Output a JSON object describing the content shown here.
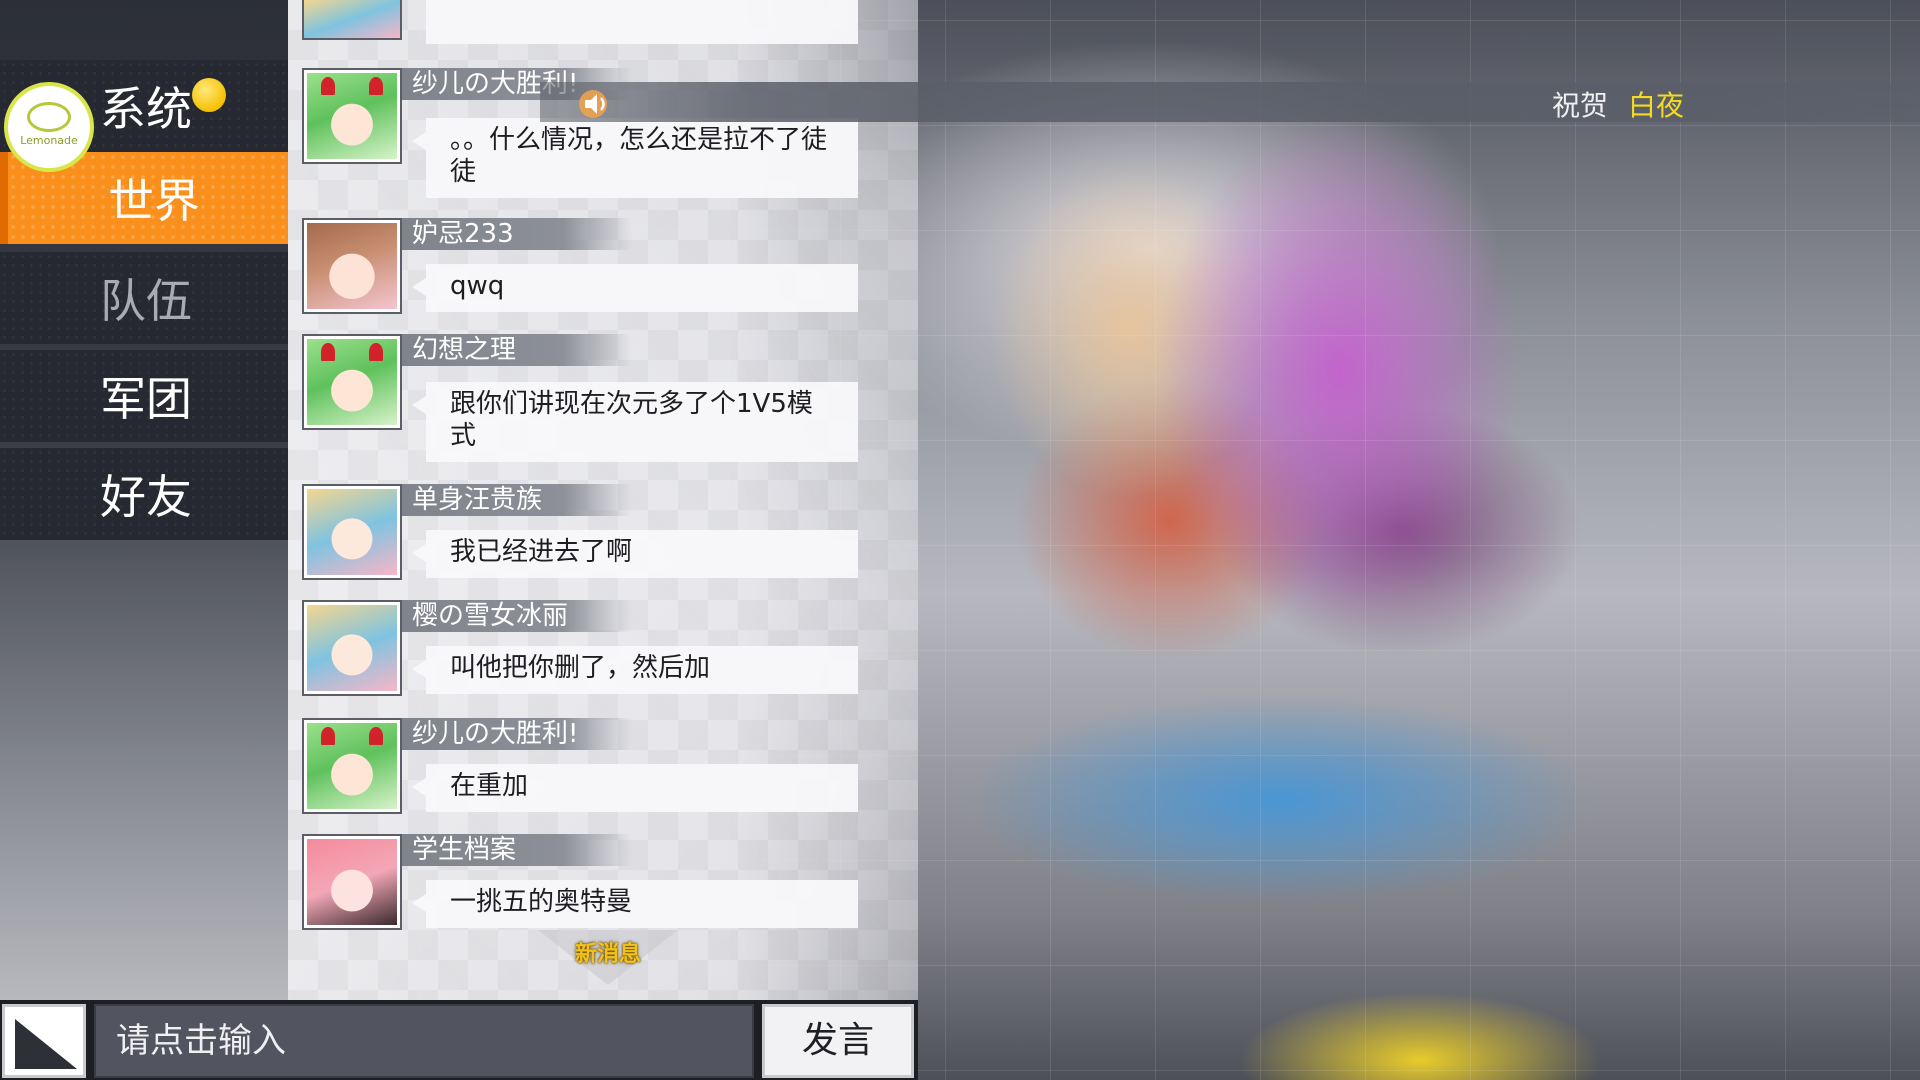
{
  "sidebar": {
    "items": [
      {
        "label": "系统"
      },
      {
        "label": "世界"
      },
      {
        "label": "队伍"
      },
      {
        "label": "军团"
      },
      {
        "label": "好友"
      }
    ],
    "active_index": 1,
    "logo_text": "Lemonade"
  },
  "banner": {
    "congrats": "祝贺",
    "name": "白夜"
  },
  "messages": [
    {
      "name": "纱儿の大胜利!",
      "text": "。。什么情况，怎么还是拉不了徒徒",
      "avatar": "green-hair-horns"
    },
    {
      "name": "妒忌233",
      "text": "qwq",
      "avatar": "brown-hair"
    },
    {
      "name": "幻想之理",
      "text": "跟你们讲现在次元多了个1V5模式",
      "avatar": "green-hair-horns"
    },
    {
      "name": "单身汪贵族",
      "text": "我已经进去了啊",
      "avatar": "blonde-hair"
    },
    {
      "name": "樱の雪女冰丽",
      "text": "叫他把你删了，然后加",
      "avatar": "blonde-hair"
    },
    {
      "name": "纱儿の大胜利!",
      "text": "在重加",
      "avatar": "green-hair-horns"
    },
    {
      "name": "学生档案",
      "text": "一挑五的奥特曼",
      "avatar": "pink-hair"
    }
  ],
  "new_message_label": "新消息",
  "input": {
    "placeholder": "请点击输入",
    "send_label": "发言"
  },
  "colors": {
    "accent": "#fb8f1c",
    "banner_name": "#f5da24"
  }
}
